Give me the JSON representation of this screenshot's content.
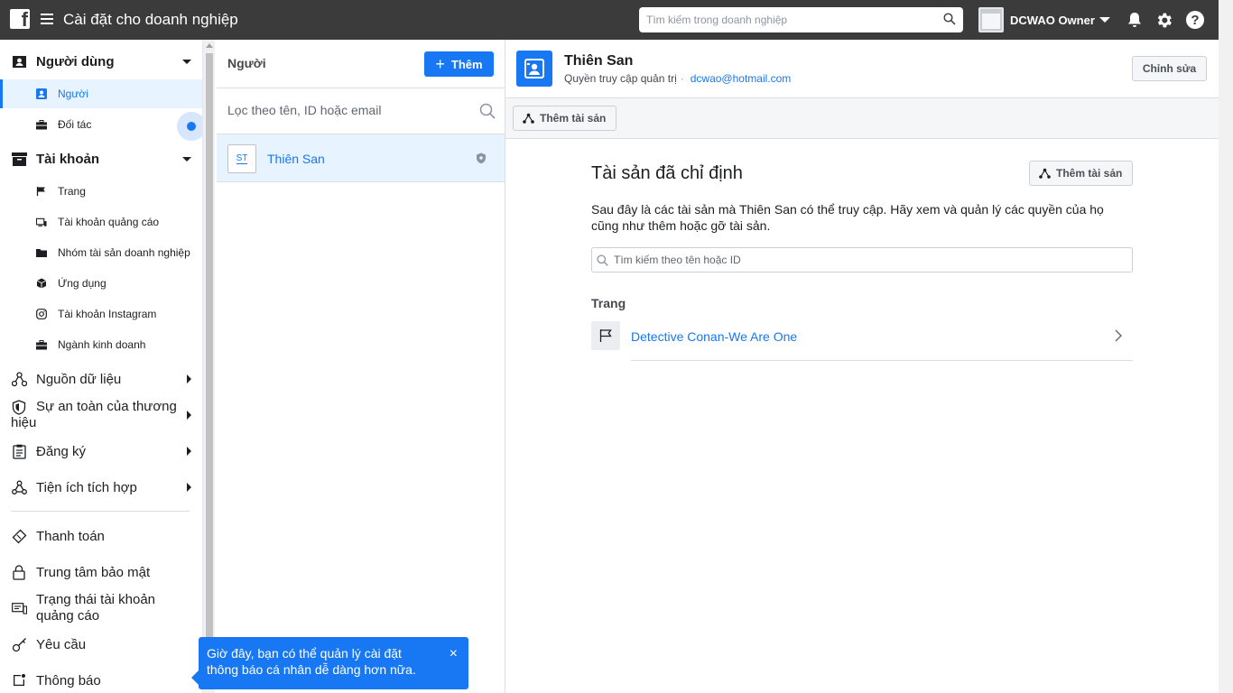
{
  "header": {
    "app_title": "Cài đặt cho doanh nghiệp",
    "search_placeholder": "Tìm kiếm trong doanh nghiệp",
    "account_name": "DCWAO Owner"
  },
  "sidebar": {
    "users_section": "Người dùng",
    "users_items": [
      {
        "label": "Người",
        "icon": "person-icon",
        "active": true
      },
      {
        "label": "Đối tác",
        "icon": "briefcase-icon",
        "active": false
      }
    ],
    "accounts_section": "Tài khoản",
    "accounts_items": [
      {
        "label": "Trang",
        "icon": "flag-icon"
      },
      {
        "label": "Tài khoản quảng cáo",
        "icon": "ad-account-icon"
      },
      {
        "label": "Nhóm tài sản doanh nghiệp",
        "icon": "folder-icon"
      },
      {
        "label": "Ứng dụng",
        "icon": "cube-icon"
      },
      {
        "label": "Tài khoản Instagram",
        "icon": "instagram-icon"
      },
      {
        "label": "Ngành kinh doanh",
        "icon": "briefcase-icon"
      }
    ],
    "data_sources": "Nguồn dữ liệu",
    "brand_safety": "Sự an toàn của thương hiệu",
    "registrations": "Đăng ký",
    "integrations": "Tiện ích tích hợp",
    "payments": "Thanh toán",
    "security_center": "Trung tâm bảo mật",
    "ad_account_status": "Trạng thái tài khoản quảng cáo",
    "requests": "Yêu cầu",
    "notifications": "Thông báo"
  },
  "people_panel": {
    "title": "Người",
    "add_label": "Thêm",
    "filter_placeholder": "Lọc theo tên, ID hoặc email",
    "people": [
      {
        "initials": "ST",
        "name": "Thiên San"
      }
    ]
  },
  "detail": {
    "name": "Thiên San",
    "role": "Quyền truy cập quản trị",
    "separator": "·",
    "email": "dcwao@hotmail.com",
    "edit_label": "Chỉnh sửa",
    "add_asset_label": "Thêm tài sản",
    "assets_title": "Tài sản đã chỉ định",
    "assets_add_label": "Thêm tài sản",
    "assets_desc": "Sau đây là các tài sản mà Thiên San có thể truy cập. Hãy xem và quản lý các quyền của họ cũng như thêm hoặc gỡ tài sản.",
    "assets_search_placeholder": "Tìm kiếm theo tên hoặc ID",
    "group_label": "Trang",
    "assets": [
      {
        "name": "Detective Conan-We Are One",
        "icon": "flag-icon"
      }
    ]
  },
  "toast": {
    "message": "Giờ đây, bạn có thể quản lý cài đặt thông báo cá nhân dễ dàng hơn nữa.",
    "close": "×"
  },
  "colors": {
    "topbar": "#3b3b3b",
    "accent": "#1877f2",
    "active_bg": "#e7f3ff"
  }
}
